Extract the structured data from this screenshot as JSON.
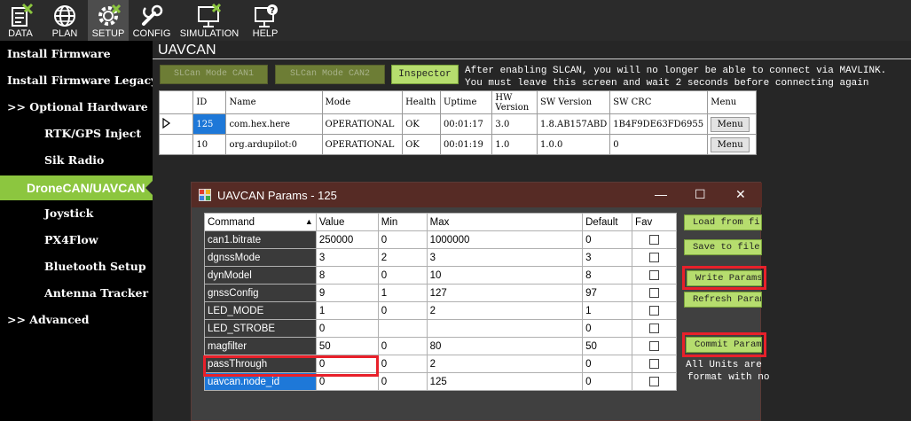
{
  "toolbar": {
    "items": [
      {
        "label": "DATA",
        "icon": "data-icon"
      },
      {
        "label": "PLAN",
        "icon": "globe-icon"
      },
      {
        "label": "SETUP",
        "icon": "gear-icon"
      },
      {
        "label": "CONFIG",
        "icon": "wrench-icon"
      },
      {
        "label": "SIMULATION",
        "icon": "monitor-icon"
      },
      {
        "label": "HELP",
        "icon": "help-monitor-icon"
      }
    ]
  },
  "sidebar": {
    "items": [
      {
        "label": "Install Firmware"
      },
      {
        "label": "Install Firmware Legacy"
      },
      {
        "label": ">> Optional Hardware"
      },
      {
        "label": "RTK/GPS Inject"
      },
      {
        "label": "Sik Radio"
      },
      {
        "label": "DroneCAN/UAVCAN"
      },
      {
        "label": "Joystick"
      },
      {
        "label": "PX4Flow"
      },
      {
        "label": "Bluetooth Setup"
      },
      {
        "label": "Antenna Tracker"
      },
      {
        "label": ">> Advanced"
      }
    ]
  },
  "main": {
    "title": "UAVCAN",
    "slcan_can1": "SLCan Mode CAN1",
    "slcan_can2": "SLCan Mode CAN2",
    "inspector": "Inspector",
    "notice_line1": "After enabling SLCAN, you will no longer be able to connect via MAVLINK.",
    "notice_line2": "You must leave this screen and wait 2 seconds before connecting again"
  },
  "nodes": {
    "headers": [
      "ID",
      "Name",
      "Mode",
      "Health",
      "Uptime",
      "HW Version",
      "SW Version",
      "SW CRC",
      "Menu"
    ],
    "rows": [
      [
        "125",
        "com.hex.here",
        "OPERATIONAL",
        "OK",
        "00:01:17",
        "3.0",
        "1.8.AB157ABD",
        "1B4F9DE63FD6955",
        "Menu"
      ],
      [
        "10",
        "org.ardupilot:0",
        "OPERATIONAL",
        "OK",
        "00:01:19",
        "1.0",
        "1.0.0",
        "0",
        "Menu"
      ]
    ]
  },
  "dialog": {
    "title": "UAVCAN Params - 125",
    "minimize": "—",
    "maximize": "☐",
    "close": "✕",
    "headers": [
      "Command",
      "Value",
      "Min",
      "Max",
      "Default",
      "Fav"
    ],
    "sort_indicator": "▲",
    "rows": [
      [
        "can1.bitrate",
        "250000",
        "0",
        "1000000",
        "0"
      ],
      [
        "dgnssMode",
        "3",
        "2",
        "3",
        "3"
      ],
      [
        "dynModel",
        "8",
        "0",
        "10",
        "8"
      ],
      [
        "gnssConfig",
        "9",
        "1",
        "127",
        "97"
      ],
      [
        "LED_MODE",
        "1",
        "0",
        "2",
        "1"
      ],
      [
        "LED_STROBE",
        "0",
        "",
        "",
        "0"
      ],
      [
        "magfilter",
        "50",
        "0",
        "80",
        "50"
      ],
      [
        "passThrough",
        "0",
        "0",
        "2",
        "0"
      ],
      [
        "uavcan.node_id",
        "0",
        "0",
        "125",
        "0"
      ]
    ],
    "buttons": {
      "load": "Load from file",
      "save": "Save to file",
      "write": "Write Params",
      "refresh": "Refresh Params",
      "commit": "Commit Params"
    },
    "note_line1": "All Units are",
    "note_line2": "format with no"
  },
  "colors": {
    "accent": "#8cc63f",
    "button_green": "#b6dd6e",
    "highlight_red": "#e8202a",
    "selection_blue": "#1e78d8"
  }
}
